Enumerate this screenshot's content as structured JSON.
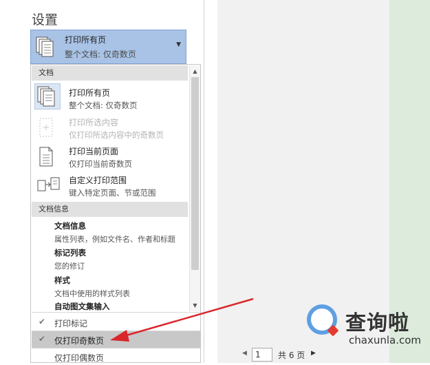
{
  "settings": {
    "heading": "设置",
    "selector": {
      "title": "打印所有页",
      "subtitle": "整个文档: 仅奇数页"
    }
  },
  "dropdown": {
    "section_document": "文档",
    "items": [
      {
        "label": "打印所有页",
        "desc": "整个文档: 仅奇数页",
        "icon": "pages-stack-icon",
        "state": "selected"
      },
      {
        "label": "打印所选内容",
        "desc": "仅打印所选内容中的奇数页",
        "icon": "selection-page-icon",
        "state": "disabled"
      },
      {
        "label": "打印当前页面",
        "desc": "仅打印当前奇数页",
        "icon": "single-page-icon",
        "state": "normal"
      },
      {
        "label": "自定义打印范围",
        "desc": "键入特定页面、节或范围",
        "icon": "custom-range-icon",
        "state": "normal"
      }
    ],
    "section_info": "文档信息",
    "info_items": [
      {
        "label": "文档信息",
        "desc": "属性列表，例如文件名、作者和标题"
      },
      {
        "label": "标记列表",
        "desc": "您的修订"
      },
      {
        "label": "样式",
        "desc": "文档中使用的样式列表"
      },
      {
        "label": "自动图文集输入"
      }
    ],
    "options": [
      {
        "label": "打印标记",
        "checked": true
      },
      {
        "label": "仅打印奇数页",
        "checked": true,
        "highlighted": true
      },
      {
        "label": "仅打印偶数页",
        "checked": false
      }
    ]
  },
  "pager": {
    "current": "1",
    "total": "共 6 页"
  },
  "watermark": {
    "brand": "查询啦",
    "domain": "chaxunla.com"
  },
  "colors": {
    "selector_bg": "#a9c3e6",
    "arrow": "#d9262b",
    "highlight": "#c8c8c8",
    "green_panel": "#dcebdc"
  }
}
